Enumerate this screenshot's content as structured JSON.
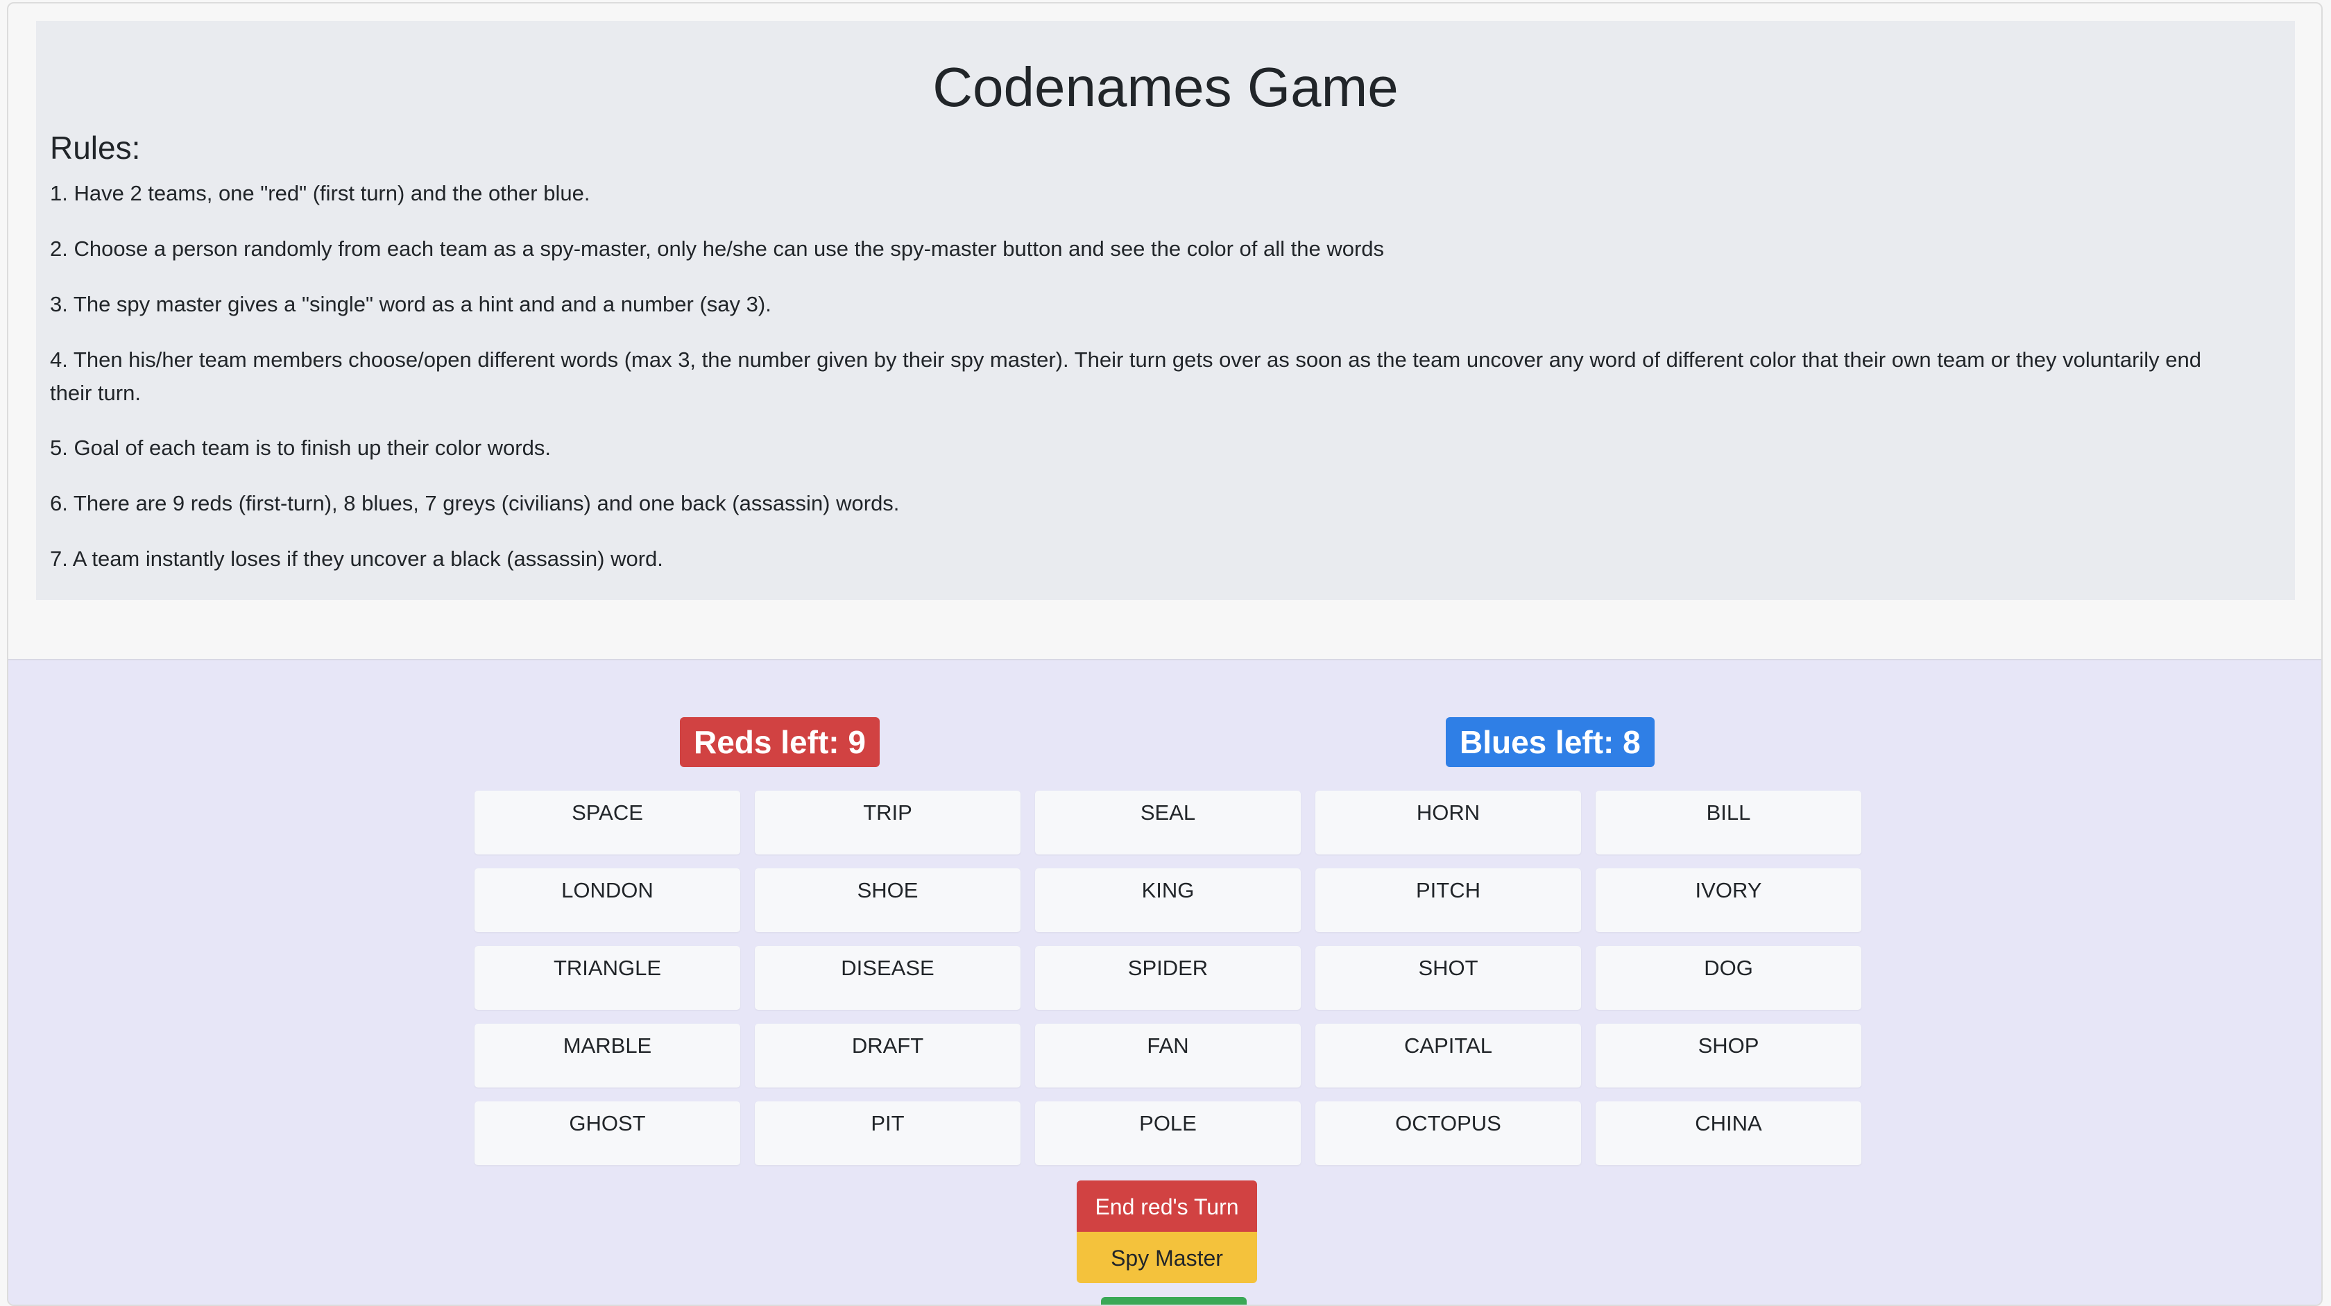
{
  "header": {
    "title": "Codenames Game",
    "rules_heading": "Rules:",
    "rules": [
      "1. Have 2 teams, one \"red\" (first turn) and the other blue.",
      "2. Choose a person randomly from each team as a spy-master, only he/she can use the spy-master button and see the color of all the words",
      "3. The spy master gives a \"single\" word as a hint and and a number (say 3).",
      "4. Then his/her team members choose/open different words (max 3, the number given by their spy master). Their turn gets over as soon as the team uncover any word of different color that their own team or they voluntarily end their turn.",
      "5. Goal of each team is to finish up their color words.",
      "6. There are 9 reds (first-turn), 8 blues, 7 greys (civilians) and one back (assassin) words.",
      "7. A team instantly loses if they uncover a black (assassin) word."
    ]
  },
  "scoreboard": {
    "reds_left": "Reds left: 9",
    "blues_left": "Blues left: 8"
  },
  "board": {
    "words": [
      "SPACE",
      "TRIP",
      "SEAL",
      "HORN",
      "BILL",
      "LONDON",
      "SHOE",
      "KING",
      "PITCH",
      "IVORY",
      "TRIANGLE",
      "DISEASE",
      "SPIDER",
      "SHOT",
      "DOG",
      "MARBLE",
      "DRAFT",
      "FAN",
      "CAPITAL",
      "SHOP",
      "GHOST",
      "PIT",
      "POLE",
      "OCTOPUS",
      "CHINA"
    ]
  },
  "controls": {
    "end_turn_label": "End red's Turn",
    "spy_master_label": "Spy Master"
  },
  "colors": {
    "red": "#d14242",
    "blue": "#2f7fe6",
    "yellow": "#f4c23c",
    "green": "#3aa856"
  }
}
